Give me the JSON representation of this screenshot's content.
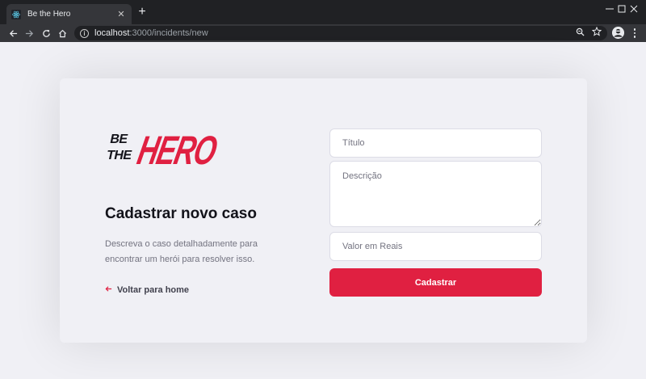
{
  "browser": {
    "tab_title": "Be the Hero",
    "url_host": "localhost",
    "url_path": ":3000/incidents/new"
  },
  "logo": {
    "line1": "BE",
    "line2": "THE",
    "word": "HERO"
  },
  "page": {
    "title": "Cadastrar novo caso",
    "description": "Descreva o caso detalhadamente para encontrar um herói para resolver isso.",
    "back_label": "Voltar para home"
  },
  "form": {
    "title_placeholder": "Título",
    "description_placeholder": "Descrição",
    "value_placeholder": "Valor em Reais",
    "submit_label": "Cadastrar"
  },
  "colors": {
    "accent": "#e02041",
    "background": "#f0f0f5",
    "heading": "#13131a",
    "muted_text": "#737380",
    "chrome_dark": "#202124",
    "chrome_toolbar": "#35363a"
  },
  "icons": {
    "favicon": "react-icon",
    "back": "arrow-left-icon",
    "window_controls": [
      "minimize-icon",
      "maximize-icon",
      "close-icon"
    ]
  }
}
